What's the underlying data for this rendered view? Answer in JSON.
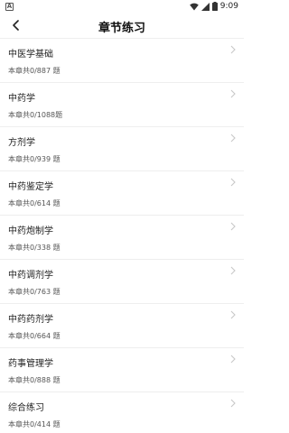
{
  "status_bar": {
    "left_icon_label": "A",
    "time": "9:09",
    "icons": [
      "wifi-icon",
      "signal-icon",
      "battery-icon"
    ]
  },
  "header": {
    "back_icon": "chevron-left-icon",
    "title": "章节练习"
  },
  "chapters": [
    {
      "title": "中医学基础",
      "count": "本章共0/887 题"
    },
    {
      "title": "中药学",
      "count": "本章共0/1088题"
    },
    {
      "title": "方剂学",
      "count": "本章共0/939 题"
    },
    {
      "title": "中药鉴定学",
      "count": "本章共0/614 题"
    },
    {
      "title": "中药炮制学",
      "count": "本章共0/338 题"
    },
    {
      "title": "中药调剂学",
      "count": "本章共0/763 题"
    },
    {
      "title": "中药药剂学",
      "count": "本章共0/664 题"
    },
    {
      "title": "药事管理学",
      "count": "本章共0/888 题"
    },
    {
      "title": "综合练习",
      "count": "本章共0/414 题"
    }
  ],
  "colors": {
    "background": "#ffffff",
    "divider": "#eeeeee",
    "chevron": "#c8c8c8"
  }
}
